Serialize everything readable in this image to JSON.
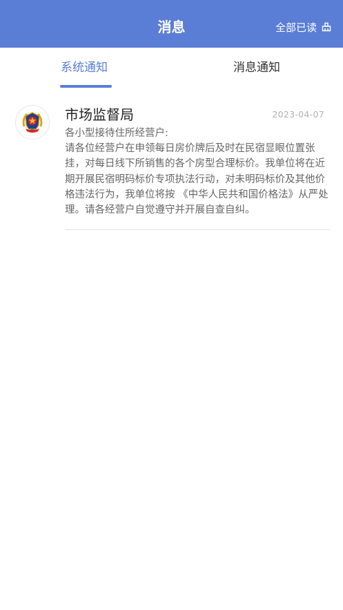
{
  "header": {
    "title": "消息",
    "read_all_label": "全部已读",
    "read_all_icon": "broom-icon"
  },
  "tabs": [
    {
      "label": "系统通知",
      "active": true
    },
    {
      "label": "消息通知",
      "active": false
    }
  ],
  "messages": [
    {
      "sender": "市场监督局",
      "date": "2023-04-07",
      "avatar_icon": "police-emblem-icon",
      "greeting": "各小型接待住所经营户:",
      "body": "请各位经营户在申领每日房价牌后及时在民宿显眼位置张挂，对每日线下所销售的各个房型合理标价。我单位将在近期开展民宿明码标价专项执法行动，对未明码标价及其他价格违法行为，我单位将按 《中华人民共和国价格法》从严处理。请各经营户自觉遵守并开展自查自纠。"
    }
  ],
  "colors": {
    "header_bg": "#5a7ed6",
    "accent": "#5a7ed6",
    "text_primary": "#222222",
    "text_secondary": "#666666",
    "date": "#b0b0b0"
  }
}
